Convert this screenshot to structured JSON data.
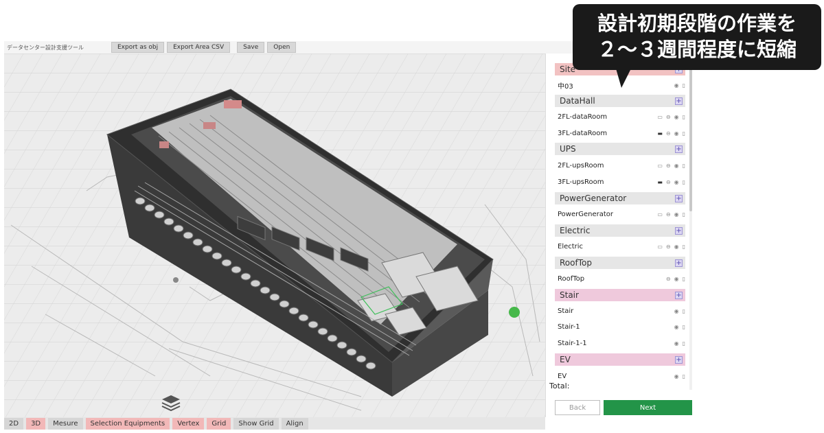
{
  "app_title": "データセンター設計支援ツール",
  "toolbar": {
    "export_obj": "Export as obj",
    "export_csv": "Export Area CSV",
    "save": "Save",
    "open": "Open"
  },
  "panel": {
    "site_header": "Site",
    "site_item": "中03",
    "datahall": {
      "header": "DataHall",
      "items": [
        "2FL-dataRoom",
        "3FL-dataRoom"
      ]
    },
    "ups": {
      "header": "UPS",
      "items": [
        "2FL-upsRoom",
        "3FL-upsRoom"
      ]
    },
    "powergen": {
      "header": "PowerGenerator",
      "items": [
        "PowerGenerator"
      ]
    },
    "electric": {
      "header": "Electric",
      "items": [
        "Electric"
      ]
    },
    "rooftop": {
      "header": "RoofTop",
      "items": [
        "RoofTop"
      ]
    },
    "stair": {
      "header": "Stair",
      "items": [
        "Stair",
        "Stair-1",
        "Stair-1-1"
      ]
    },
    "ev": {
      "header": "EV",
      "items": [
        "EV"
      ]
    },
    "total_label": "Total:",
    "back": "Back",
    "next": "Next",
    "plus": "+"
  },
  "bottombar": {
    "btn_2d": "2D",
    "btn_3d": "3D",
    "mesure": "Mesure",
    "selection": "Selection Equipments",
    "vertex": "Vertex",
    "grid": "Grid",
    "show_grid": "Show Grid",
    "align": "Align"
  },
  "callout": {
    "line1": "設計初期段階の作業を",
    "line2": "２～３週間程度に短縮"
  },
  "colors": {
    "accent_green": "#239448",
    "active_toggle": "#f2b8b8",
    "section_pink": "#efc9dc"
  }
}
